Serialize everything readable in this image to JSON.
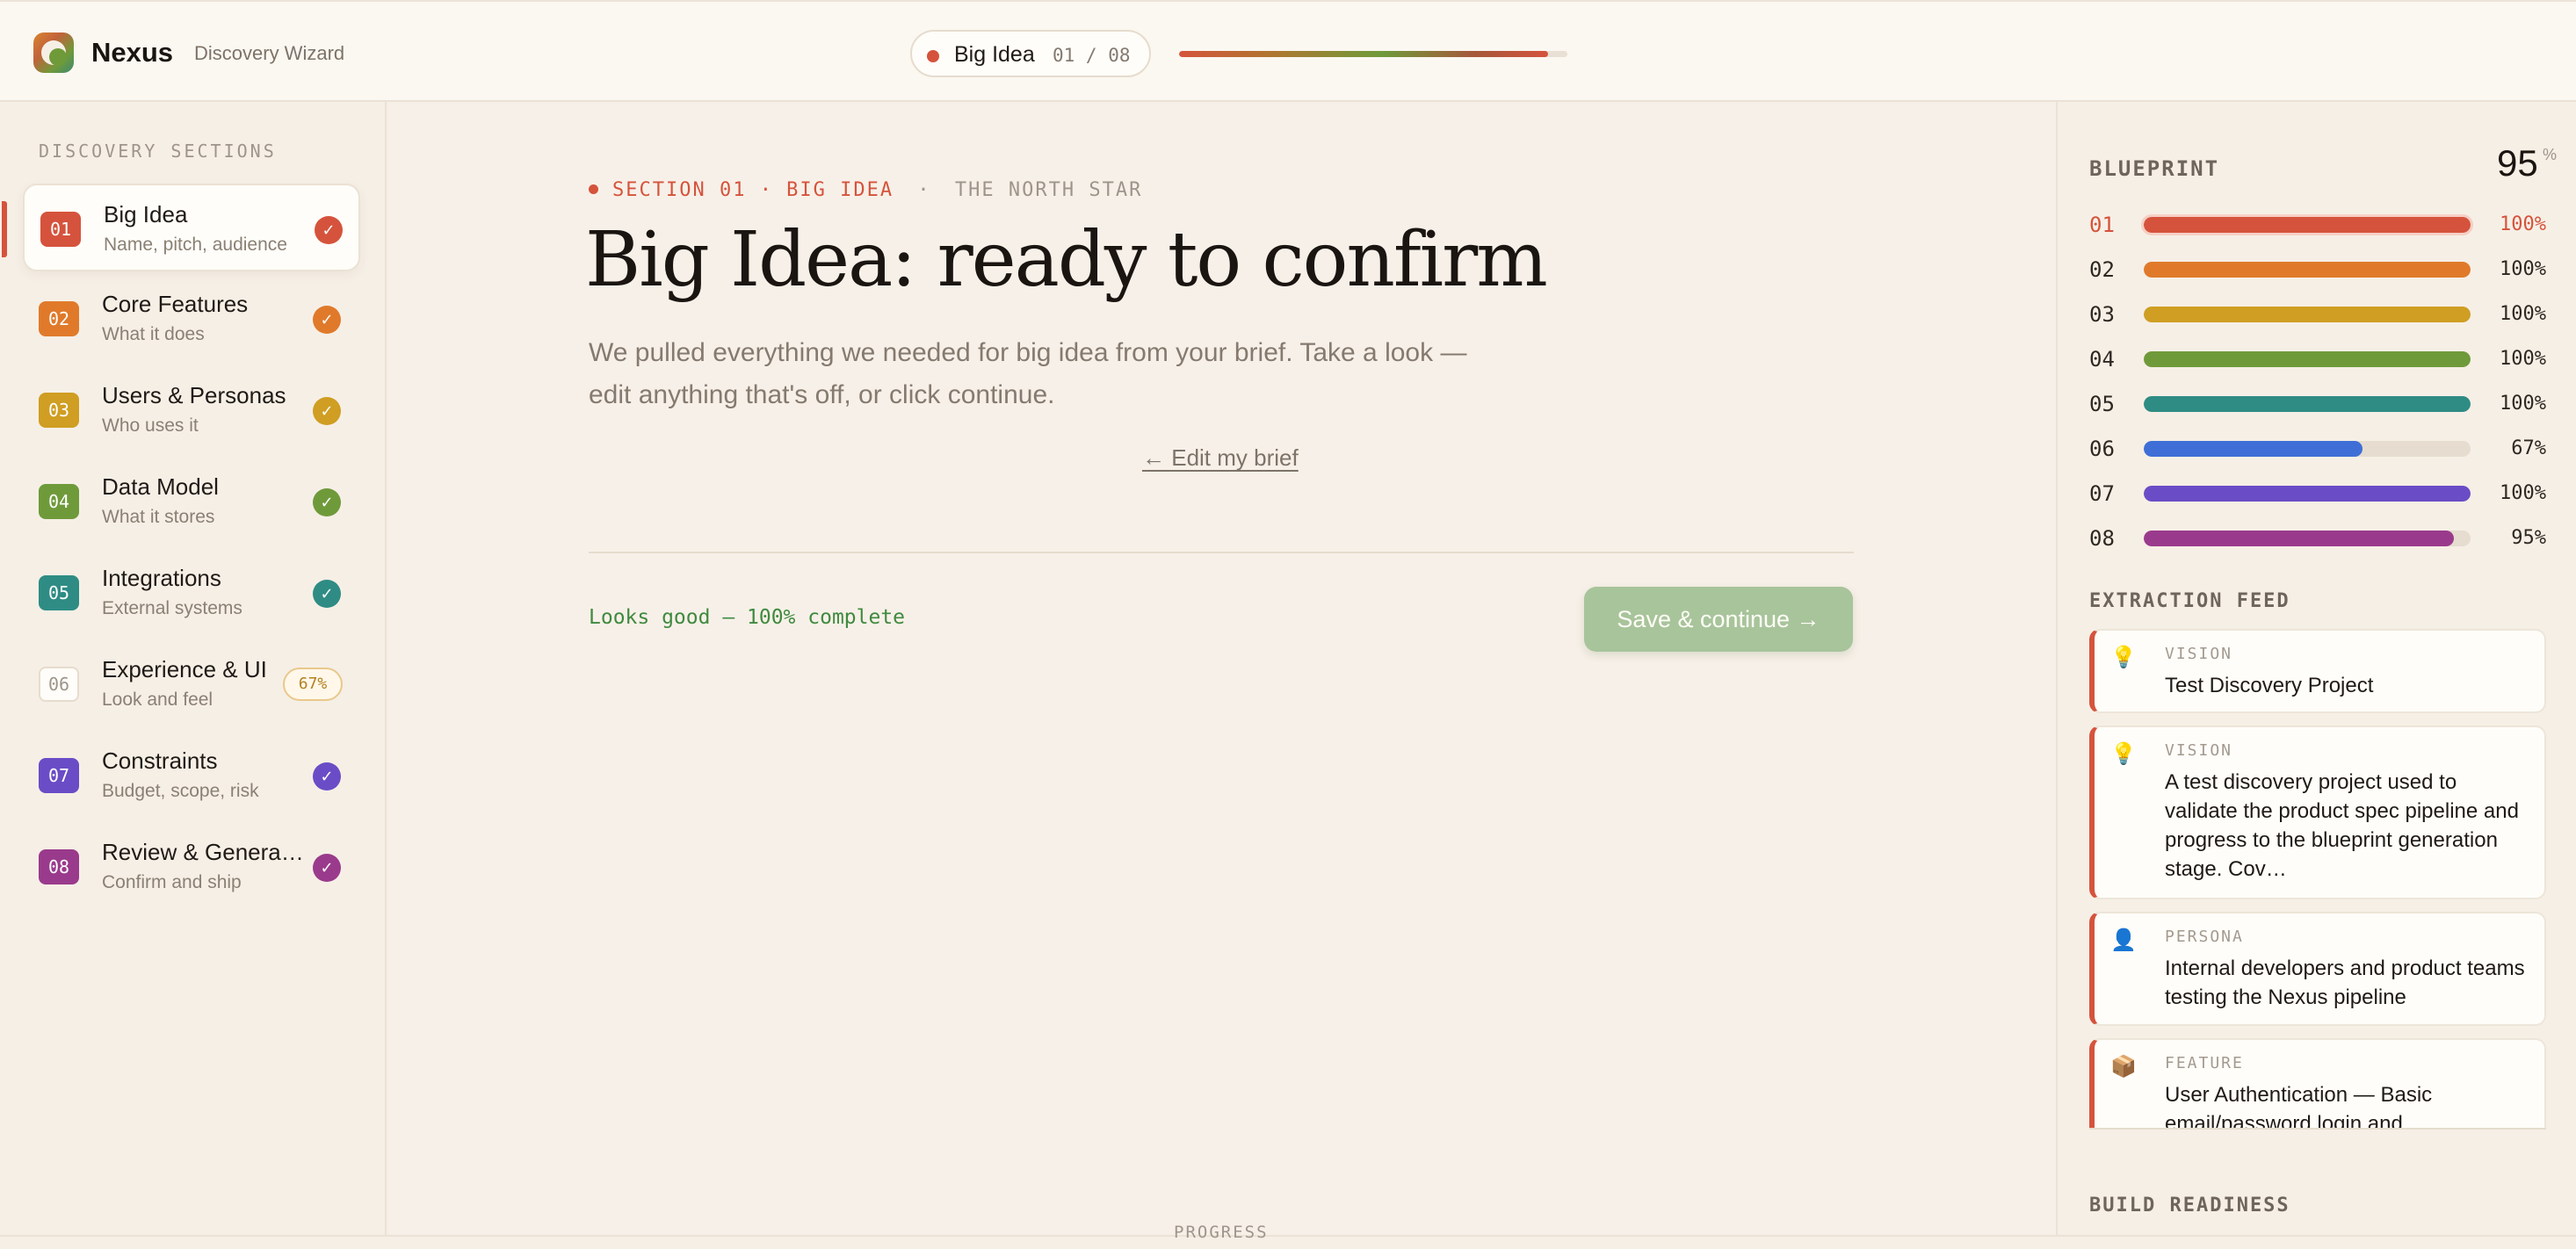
{
  "app": {
    "name": "Nexus",
    "subtitle": "Discovery Wizard"
  },
  "header": {
    "step_title": "Big Idea",
    "step_count": "01 / 08",
    "progress": 0.95
  },
  "sidebar": {
    "heading": "DISCOVERY SECTIONS",
    "items": [
      {
        "num": "01",
        "title": "Big Idea",
        "sub": "Name, pitch, audience",
        "color": "#d5533c",
        "status": "done",
        "active": true
      },
      {
        "num": "02",
        "title": "Core Features",
        "sub": "What it does",
        "color": "#e07a2a",
        "status": "done"
      },
      {
        "num": "03",
        "title": "Users & Personas",
        "sub": "Who uses it",
        "color": "#cf9e22",
        "status": "done"
      },
      {
        "num": "04",
        "title": "Data Model",
        "sub": "What it stores",
        "color": "#6f9a3a",
        "status": "done"
      },
      {
        "num": "05",
        "title": "Integrations",
        "sub": "External systems",
        "color": "#2e8c84",
        "status": "done"
      },
      {
        "num": "06",
        "title": "Experience & UI",
        "sub": "Look and feel",
        "color": "#9e958a",
        "status": "partial",
        "pct": "67%"
      },
      {
        "num": "07",
        "title": "Constraints",
        "sub": "Budget, scope, risk",
        "color": "#6a4cc6",
        "status": "done"
      },
      {
        "num": "08",
        "title": "Review & Genera…",
        "sub": "Confirm and ship",
        "color": "#9a3a8c",
        "status": "done"
      }
    ]
  },
  "main": {
    "eyebrow_section": "SECTION 01 · BIG IDEA",
    "eyebrow_sep": "·",
    "eyebrow_tag": "THE NORTH STAR",
    "title": "Big Idea: ready to confirm",
    "description": "We pulled everything we needed for big idea from your brief. Take a look — edit anything that's off, or click continue.",
    "edit_link": "← Edit my brief",
    "status": "Looks good — 100% complete",
    "save_button": "Save & continue →"
  },
  "blueprint": {
    "label": "BLUEPRINT",
    "value": "95",
    "unit": "%",
    "rows": [
      {
        "num": "01",
        "value": "100%",
        "fill": 1.0,
        "color": "#d5533c",
        "active": true
      },
      {
        "num": "02",
        "value": "100%",
        "fill": 1.0,
        "color": "#e07a2a"
      },
      {
        "num": "03",
        "value": "100%",
        "fill": 1.0,
        "color": "#cf9e22"
      },
      {
        "num": "04",
        "value": "100%",
        "fill": 1.0,
        "color": "#6f9a3a"
      },
      {
        "num": "05",
        "value": "100%",
        "fill": 1.0,
        "color": "#2e8c84"
      },
      {
        "num": "06",
        "value": "67%",
        "fill": 0.67,
        "color": "#3f6fd6"
      },
      {
        "num": "07",
        "value": "100%",
        "fill": 1.0,
        "color": "#6a4cc6"
      },
      {
        "num": "08",
        "value": "95%",
        "fill": 0.95,
        "color": "#9a3a8c"
      }
    ]
  },
  "feed": {
    "label": "EXTRACTION FEED",
    "items": [
      {
        "icon": "💡",
        "icon_name": "lightbulb-icon",
        "kind": "VISION",
        "text": "Test Discovery Project"
      },
      {
        "icon": "💡",
        "icon_name": "lightbulb-icon",
        "kind": "VISION",
        "text": "A test discovery project used to validate the product spec pipeline and progress to the blueprint generation stage. Cov…"
      },
      {
        "icon": "👤",
        "icon_name": "person-icon",
        "kind": "PERSONA",
        "text": "Internal developers and product teams testing the Nexus pipeline"
      },
      {
        "icon": "📦",
        "icon_name": "package-icon",
        "kind": "FEATURE",
        "text": "User Authentication — Basic email/password login and"
      }
    ]
  },
  "build_readiness": {
    "label": "BUILD READINESS"
  },
  "footer": {
    "label": "PROGRESS"
  }
}
